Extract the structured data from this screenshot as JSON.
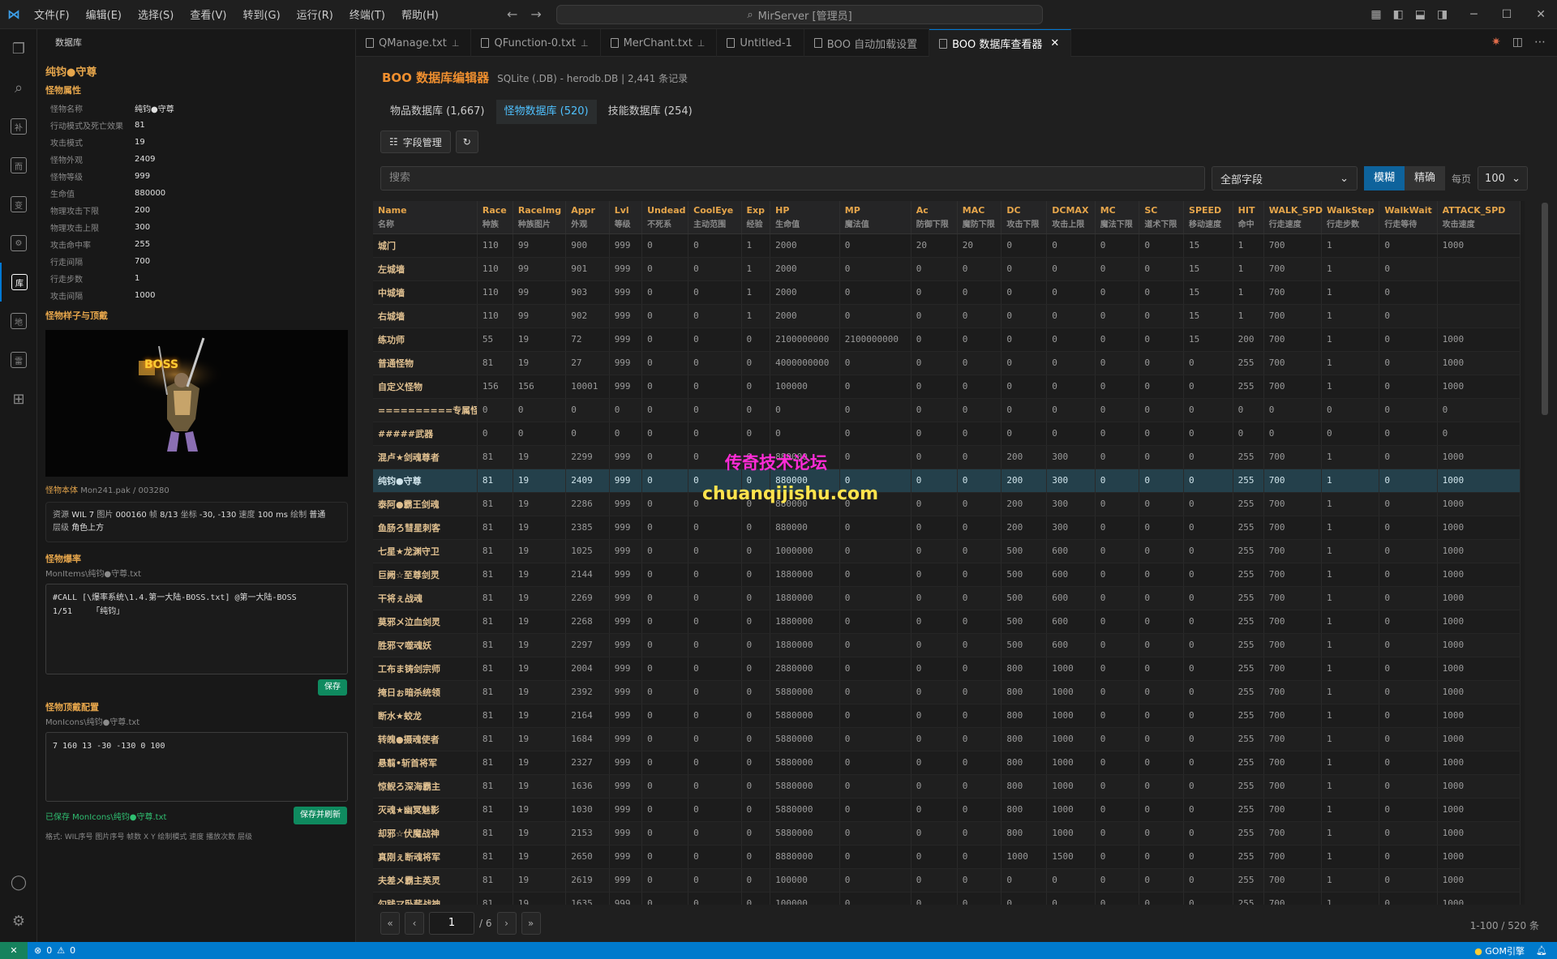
{
  "window": {
    "menu": [
      "文件(F)",
      "编辑(E)",
      "选择(S)",
      "查看(V)",
      "转到(G)",
      "运行(R)",
      "终端(T)",
      "帮助(H)"
    ],
    "command_center": "MirServer [管理员]"
  },
  "sidebar": {
    "header": "数据库",
    "monster_title": "纯钧●守尊",
    "attr_section": "怪物属性",
    "props": [
      {
        "k": "怪物名称",
        "v": "纯钧●守尊"
      },
      {
        "k": "行动模式及死亡效果",
        "v": "81"
      },
      {
        "k": "攻击模式",
        "v": "19"
      },
      {
        "k": "怪物外观",
        "v": "2409"
      },
      {
        "k": "怪物等级",
        "v": "999"
      },
      {
        "k": "生命值",
        "v": "880000"
      },
      {
        "k": "物理攻击下限",
        "v": "200"
      },
      {
        "k": "物理攻击上限",
        "v": "300"
      },
      {
        "k": "攻击命中率",
        "v": "255"
      },
      {
        "k": "行走间隔",
        "v": "700"
      },
      {
        "k": "行走步数",
        "v": "1"
      },
      {
        "k": "攻击间隔",
        "v": "1000"
      }
    ],
    "preview_section": "怪物样子与顶戴",
    "boss_label": "BOSS",
    "body_file_label": "怪物本体",
    "body_file": "Mon241.pak / 003280",
    "info": {
      "line1_res_label": "资源",
      "line1_res": "WIL 7",
      "line1_img_label": "图片",
      "line1_img": "000160",
      "line1_frame_label": "帧",
      "line1_frame": "8/13",
      "line1_coord_label": "坐标",
      "line1_coord": "-30, -130",
      "line1_speed_label": "速度",
      "line1_speed": "100 ms",
      "line1_draw_label": "绘制",
      "line1_draw": "普通",
      "line2_layer_label": "层级",
      "line2_layer": "角色上方"
    },
    "drop_section": "怪物爆率",
    "drop_path": "MonItems\\纯钧●守尊.txt",
    "drop_text": "#CALL [\\爆率系统\\1.4.第一大陆-BOSS.txt] @第一大陆-BOSS\n1/51    「纯钧」",
    "save_label": "保存",
    "head_section": "怪物顶戴配置",
    "head_path": "MonIcons\\纯钧●守尊.txt",
    "head_text": "7 160 13 -30 -130 0 100",
    "saved_msg": "已保存 MonIcons\\纯钧●守尊.txt",
    "save_refresh_label": "保存并刷新",
    "format_hint": "格式: WIL序号 图片序号 帧数 X Y 绘制模式 速度 播放次数 层级"
  },
  "tabs": [
    {
      "label": "QManage.txt",
      "pinned": true
    },
    {
      "label": "QFunction-0.txt",
      "pinned": true
    },
    {
      "label": "MerChant.txt",
      "pinned": true
    },
    {
      "label": "Untitled-1",
      "pinned": false
    },
    {
      "label": "BOO 自动加载设置",
      "pinned": false
    },
    {
      "label": "BOO 数据库查看器",
      "pinned": false,
      "active": true
    }
  ],
  "panel": {
    "title": "BOO 数据库编辑器",
    "subtitle": "SQLite (.DB) - herodb.DB | 2,441 条记录",
    "subtabs": [
      "物品数据库 (1,667)",
      "怪物数据库 (520)",
      "技能数据库 (254)"
    ],
    "field_mgmt": "字段管理",
    "refresh_icon": "↻",
    "search_placeholder": "搜索",
    "field_select": "全部字段",
    "mode_fuzzy": "模糊",
    "mode_exact": "精确",
    "per_page_label": "每页",
    "per_page": "100",
    "page": "1",
    "page_total": "/ 6",
    "record_count": "1-100 / 520 条"
  },
  "table": {
    "columns": [
      {
        "en": "Name",
        "zh": "名称"
      },
      {
        "en": "Race",
        "zh": "种族"
      },
      {
        "en": "RaceImg",
        "zh": "种族图片"
      },
      {
        "en": "Appr",
        "zh": "外观"
      },
      {
        "en": "Lvl",
        "zh": "等级"
      },
      {
        "en": "Undead",
        "zh": "不死系"
      },
      {
        "en": "CoolEye",
        "zh": "主动范围"
      },
      {
        "en": "Exp",
        "zh": "经验"
      },
      {
        "en": "HP",
        "zh": "生命值"
      },
      {
        "en": "MP",
        "zh": "魔法值"
      },
      {
        "en": "Ac",
        "zh": "防御下限"
      },
      {
        "en": "MAC",
        "zh": "魔防下限"
      },
      {
        "en": "DC",
        "zh": "攻击下限"
      },
      {
        "en": "DCMAX",
        "zh": "攻击上限"
      },
      {
        "en": "MC",
        "zh": "魔法下限"
      },
      {
        "en": "SC",
        "zh": "道术下限"
      },
      {
        "en": "SPEED",
        "zh": "移动速度"
      },
      {
        "en": "HIT",
        "zh": "命中"
      },
      {
        "en": "WALK_SPD",
        "zh": "行走速度"
      },
      {
        "en": "WalkStep",
        "zh": "行走步数"
      },
      {
        "en": "WalkWait",
        "zh": "行走等待"
      },
      {
        "en": "ATTACK_SPD",
        "zh": "攻击速度"
      }
    ],
    "rows": [
      [
        "城门",
        "110",
        "99",
        "900",
        "999",
        "0",
        "0",
        "1",
        "2000",
        "0",
        "20",
        "20",
        "0",
        "0",
        "0",
        "0",
        "15",
        "1",
        "700",
        "1",
        "0",
        "1000"
      ],
      [
        "左城墙",
        "110",
        "99",
        "901",
        "999",
        "0",
        "0",
        "1",
        "2000",
        "0",
        "0",
        "0",
        "0",
        "0",
        "0",
        "0",
        "15",
        "1",
        "700",
        "1",
        "0",
        ""
      ],
      [
        "中城墙",
        "110",
        "99",
        "903",
        "999",
        "0",
        "0",
        "1",
        "2000",
        "0",
        "0",
        "0",
        "0",
        "0",
        "0",
        "0",
        "15",
        "1",
        "700",
        "1",
        "0",
        ""
      ],
      [
        "右城墙",
        "110",
        "99",
        "902",
        "999",
        "0",
        "0",
        "1",
        "2000",
        "0",
        "0",
        "0",
        "0",
        "0",
        "0",
        "0",
        "15",
        "1",
        "700",
        "1",
        "0",
        ""
      ],
      [
        "练功师",
        "55",
        "19",
        "72",
        "999",
        "0",
        "0",
        "0",
        "2100000000",
        "2100000000",
        "0",
        "0",
        "0",
        "0",
        "0",
        "0",
        "15",
        "200",
        "700",
        "1",
        "0",
        "1000"
      ],
      [
        "普通怪物",
        "81",
        "19",
        "27",
        "999",
        "0",
        "0",
        "0",
        "4000000000",
        "0",
        "0",
        "0",
        "0",
        "0",
        "0",
        "0",
        "0",
        "255",
        "700",
        "1",
        "0",
        "1000"
      ],
      [
        "自定义怪物",
        "156",
        "156",
        "10001",
        "999",
        "0",
        "0",
        "0",
        "100000",
        "0",
        "0",
        "0",
        "0",
        "0",
        "0",
        "0",
        "0",
        "255",
        "700",
        "1",
        "0",
        "1000"
      ],
      [
        "==========专属怪物",
        "0",
        "0",
        "0",
        "0",
        "0",
        "0",
        "0",
        "0",
        "0",
        "0",
        "0",
        "0",
        "0",
        "0",
        "0",
        "0",
        "0",
        "0",
        "0",
        "0",
        "0"
      ],
      [
        "#####武器",
        "0",
        "0",
        "0",
        "0",
        "0",
        "0",
        "0",
        "0",
        "0",
        "0",
        "0",
        "0",
        "0",
        "0",
        "0",
        "0",
        "0",
        "0",
        "0",
        "0",
        "0"
      ],
      [
        "混卢★剑魂尊者",
        "81",
        "19",
        "2299",
        "999",
        "0",
        "0",
        "0",
        "880000",
        "0",
        "0",
        "0",
        "200",
        "300",
        "0",
        "0",
        "0",
        "255",
        "700",
        "1",
        "0",
        "1000"
      ],
      [
        "纯钧●守尊",
        "81",
        "19",
        "2409",
        "999",
        "0",
        "0",
        "0",
        "880000",
        "0",
        "0",
        "0",
        "200",
        "300",
        "0",
        "0",
        "0",
        "255",
        "700",
        "1",
        "0",
        "1000"
      ],
      [
        "泰阿●霸王剑魂",
        "81",
        "19",
        "2286",
        "999",
        "0",
        "0",
        "0",
        "880000",
        "0",
        "0",
        "0",
        "200",
        "300",
        "0",
        "0",
        "0",
        "255",
        "700",
        "1",
        "0",
        "1000"
      ],
      [
        "鱼肠ろ彗星刺客",
        "81",
        "19",
        "2385",
        "999",
        "0",
        "0",
        "0",
        "880000",
        "0",
        "0",
        "0",
        "200",
        "300",
        "0",
        "0",
        "0",
        "255",
        "700",
        "1",
        "0",
        "1000"
      ],
      [
        "七星★龙渊守卫",
        "81",
        "19",
        "1025",
        "999",
        "0",
        "0",
        "0",
        "1000000",
        "0",
        "0",
        "0",
        "500",
        "600",
        "0",
        "0",
        "0",
        "255",
        "700",
        "1",
        "0",
        "1000"
      ],
      [
        "巨阙☆至尊剑灵",
        "81",
        "19",
        "2144",
        "999",
        "0",
        "0",
        "0",
        "1880000",
        "0",
        "0",
        "0",
        "500",
        "600",
        "0",
        "0",
        "0",
        "255",
        "700",
        "1",
        "0",
        "1000"
      ],
      [
        "干将ぇ战魂",
        "81",
        "19",
        "2269",
        "999",
        "0",
        "0",
        "0",
        "1880000",
        "0",
        "0",
        "0",
        "500",
        "600",
        "0",
        "0",
        "0",
        "255",
        "700",
        "1",
        "0",
        "1000"
      ],
      [
        "莫邪メ泣血剑灵",
        "81",
        "19",
        "2268",
        "999",
        "0",
        "0",
        "0",
        "1880000",
        "0",
        "0",
        "0",
        "500",
        "600",
        "0",
        "0",
        "0",
        "255",
        "700",
        "1",
        "0",
        "1000"
      ],
      [
        "胜邪マ噬魂妖",
        "81",
        "19",
        "2297",
        "999",
        "0",
        "0",
        "0",
        "1880000",
        "0",
        "0",
        "0",
        "500",
        "600",
        "0",
        "0",
        "0",
        "255",
        "700",
        "1",
        "0",
        "1000"
      ],
      [
        "工布ま铸剑宗师",
        "81",
        "19",
        "2004",
        "999",
        "0",
        "0",
        "0",
        "2880000",
        "0",
        "0",
        "0",
        "800",
        "1000",
        "0",
        "0",
        "0",
        "255",
        "700",
        "1",
        "0",
        "1000"
      ],
      [
        "掩日ぉ暗杀统领",
        "81",
        "19",
        "2392",
        "999",
        "0",
        "0",
        "0",
        "5880000",
        "0",
        "0",
        "0",
        "800",
        "1000",
        "0",
        "0",
        "0",
        "255",
        "700",
        "1",
        "0",
        "1000"
      ],
      [
        "断水★蛟龙",
        "81",
        "19",
        "2164",
        "999",
        "0",
        "0",
        "0",
        "5880000",
        "0",
        "0",
        "0",
        "800",
        "1000",
        "0",
        "0",
        "0",
        "255",
        "700",
        "1",
        "0",
        "1000"
      ],
      [
        "转魄●摄魂使者",
        "81",
        "19",
        "1684",
        "999",
        "0",
        "0",
        "0",
        "5880000",
        "0",
        "0",
        "0",
        "800",
        "1000",
        "0",
        "0",
        "0",
        "255",
        "700",
        "1",
        "0",
        "1000"
      ],
      [
        "悬翦•斩首将军",
        "81",
        "19",
        "2327",
        "999",
        "0",
        "0",
        "0",
        "5880000",
        "0",
        "0",
        "0",
        "800",
        "1000",
        "0",
        "0",
        "0",
        "255",
        "700",
        "1",
        "0",
        "1000"
      ],
      [
        "惊鲵ろ深海霸主",
        "81",
        "19",
        "1636",
        "999",
        "0",
        "0",
        "0",
        "5880000",
        "0",
        "0",
        "0",
        "800",
        "1000",
        "0",
        "0",
        "0",
        "255",
        "700",
        "1",
        "0",
        "1000"
      ],
      [
        "灭魂★幽冥魅影",
        "81",
        "19",
        "1030",
        "999",
        "0",
        "0",
        "0",
        "5880000",
        "0",
        "0",
        "0",
        "800",
        "1000",
        "0",
        "0",
        "0",
        "255",
        "700",
        "1",
        "0",
        "1000"
      ],
      [
        "却邪☆伏魔战神",
        "81",
        "19",
        "2153",
        "999",
        "0",
        "0",
        "0",
        "5880000",
        "0",
        "0",
        "0",
        "800",
        "1000",
        "0",
        "0",
        "0",
        "255",
        "700",
        "1",
        "0",
        "1000"
      ],
      [
        "真刚ぇ断魂将军",
        "81",
        "19",
        "2650",
        "999",
        "0",
        "0",
        "0",
        "8880000",
        "0",
        "0",
        "0",
        "1000",
        "1500",
        "0",
        "0",
        "0",
        "255",
        "700",
        "1",
        "0",
        "1000"
      ],
      [
        "夫差メ霸主英灵",
        "81",
        "19",
        "2619",
        "999",
        "0",
        "0",
        "0",
        "100000",
        "0",
        "0",
        "0",
        "0",
        "0",
        "0",
        "0",
        "0",
        "255",
        "700",
        "1",
        "0",
        "1000"
      ],
      [
        "勾践マ卧薪战神",
        "81",
        "19",
        "1635",
        "999",
        "0",
        "0",
        "0",
        "100000",
        "0",
        "0",
        "0",
        "0",
        "0",
        "0",
        "0",
        "0",
        "255",
        "700",
        "1",
        "0",
        "1000"
      ]
    ],
    "selected_row": 10
  },
  "watermark": {
    "line1": "传奇技术论坛",
    "line2": "chuanqijishu.com"
  },
  "statusbar": {
    "errors": "0",
    "warnings": "0",
    "right": "GOM引擎"
  }
}
